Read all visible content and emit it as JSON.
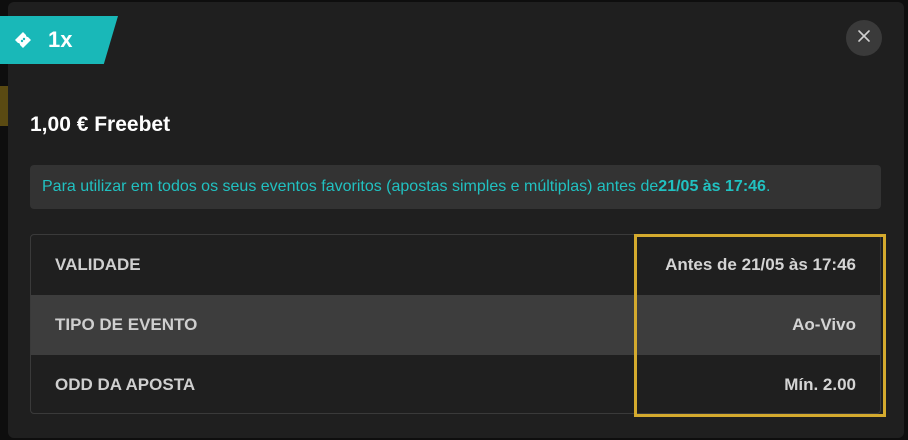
{
  "badge": {
    "label": "1x",
    "icon": "ticket-icon"
  },
  "close": {
    "icon": "close-icon"
  },
  "title": "1,00 € Freebet",
  "info": {
    "text": "Para utilizar em todos os seus eventos favoritos (apostas simples e múltiplas) antes de ",
    "date": "21/05 às 17:46",
    "suffix": "."
  },
  "details": [
    {
      "label": "VALIDADE",
      "value": "Antes de 21/05 às 17:46"
    },
    {
      "label": "TIPO DE EVENTO",
      "value": "Ao-Vivo"
    },
    {
      "label": "ODD DA APOSTA",
      "value": "Mín. 2.00"
    }
  ],
  "colors": {
    "accent": "#19b8b8",
    "info_text": "#21c1c1",
    "highlight": "#d4aa2e",
    "modal_bg": "#1f1f1f"
  }
}
